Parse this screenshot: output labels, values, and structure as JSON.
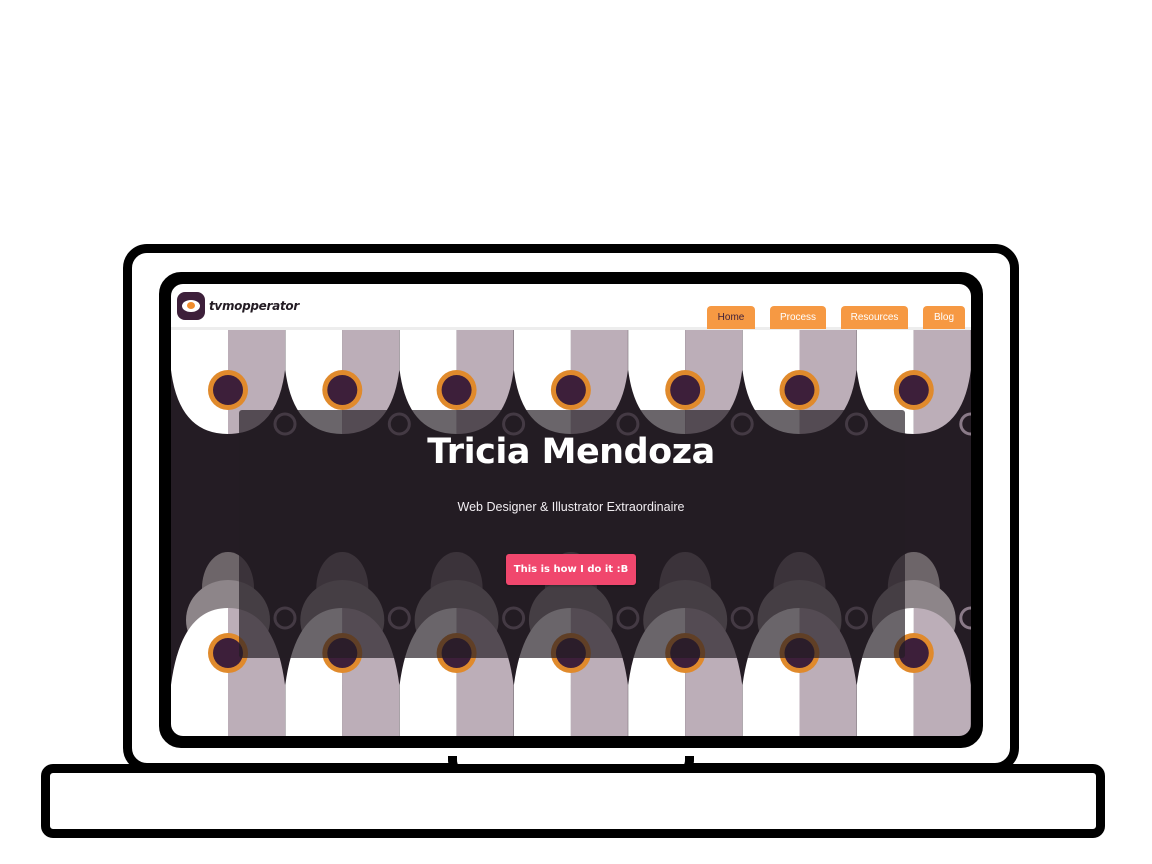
{
  "site": {
    "logo_text": "tvmopperator",
    "nav": [
      {
        "label": "Home"
      },
      {
        "label": "Process"
      },
      {
        "label": "Resources"
      },
      {
        "label": "Blog"
      }
    ]
  },
  "hero": {
    "title": "Tricia Mendoza",
    "subtitle": "Web Designer & Illustrator Extraordinaire",
    "cta_label": "This is how I do it :B"
  },
  "colors": {
    "nav_orange": "#f69943",
    "cta_pink": "#f0476d",
    "plum": "#3d1f3a",
    "mauve": "#bcaeb8",
    "dark_bg": "#241c24"
  }
}
